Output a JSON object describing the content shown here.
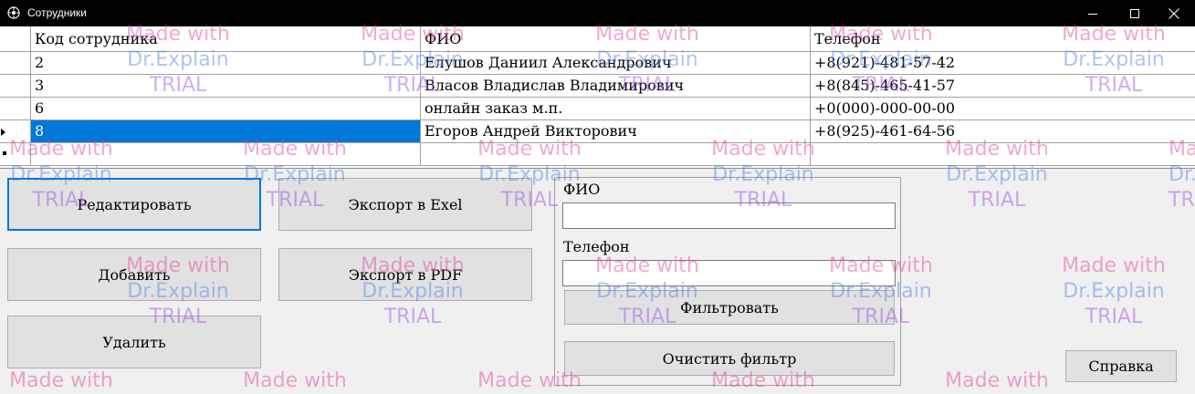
{
  "window": {
    "title": "Сотрудники",
    "controls": {
      "minimize": "minimize-icon",
      "maximize": "maximize-icon",
      "close": "close-icon"
    }
  },
  "grid": {
    "columns": [
      "Код сотрудника",
      "ФИО",
      "Телефон"
    ],
    "rows": [
      {
        "code": "2",
        "fio": "Елушов Даниил Александрович",
        "phone": "+8(921)-481-57-42"
      },
      {
        "code": "3",
        "fio": "Власов Владислав Владимирович",
        "phone": "+8(845)-465-41-57"
      },
      {
        "code": "6",
        "fio": "онлайн заказ м.п.",
        "phone": "+0(000)-000-00-00"
      },
      {
        "code": "8",
        "fio": "Егоров Андрей Викторович",
        "phone": "+8(925)-461-64-56"
      }
    ],
    "selected_row_index": 3,
    "selection_color": "#0078d7"
  },
  "actions": {
    "edit": "Редактировать",
    "export_excel": "Экспорт в Exel",
    "add": "Добавить",
    "export_pdf": "Экспорт в PDF",
    "delete": "Удалить",
    "help": "Справка"
  },
  "filter": {
    "fio_label": "ФИО",
    "fio_value": "",
    "phone_label": "Телефон",
    "phone_value": "",
    "apply": "Фильтровать",
    "clear": "Очистить фильтр"
  },
  "watermark": {
    "line1": "Made with",
    "line2": "Dr.Explain",
    "line3": "TRIAL"
  }
}
